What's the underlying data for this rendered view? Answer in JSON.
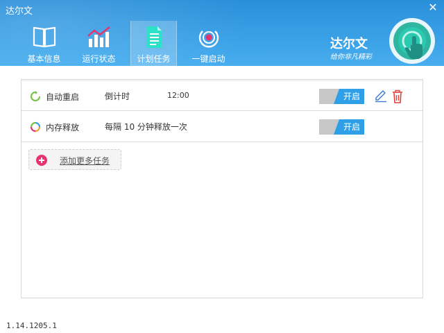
{
  "window": {
    "title": "达尔文",
    "close_icon": "close-icon"
  },
  "nav": {
    "items": [
      {
        "label": "基本信息",
        "icon": "book-icon"
      },
      {
        "label": "运行状态",
        "icon": "chart-icon"
      },
      {
        "label": "计划任务",
        "icon": "document-icon",
        "active": true
      },
      {
        "label": "一键启动",
        "icon": "power-target-icon"
      }
    ]
  },
  "brand": {
    "name": "达尔文",
    "slogan": "给你非凡精彩",
    "logo_icon": "darwin-logo-icon"
  },
  "tasks": [
    {
      "name": "自动重启",
      "schedule": "倒计时",
      "time": "12:00",
      "toggle_label": "开启",
      "enabled": true,
      "icon": "restart-icon"
    },
    {
      "name": "内存释放",
      "schedule": "每隔 10 分钟释放一次",
      "time": "",
      "toggle_label": "开启",
      "enabled": true,
      "icon": "memory-release-icon"
    }
  ],
  "row_actions": {
    "edit_icon": "edit-pencil-icon",
    "delete_icon": "trash-icon"
  },
  "add_task": {
    "label": "添加更多任务",
    "icon": "plus-circle-icon"
  },
  "footer": {
    "version": "1.14.1205.1"
  },
  "colors": {
    "header": "#3aa0e6",
    "toggle_on": "#2fa0e8",
    "toggle_off": "#c8c8c8",
    "add_plus": "#e8336e",
    "delete": "#e0403a"
  }
}
